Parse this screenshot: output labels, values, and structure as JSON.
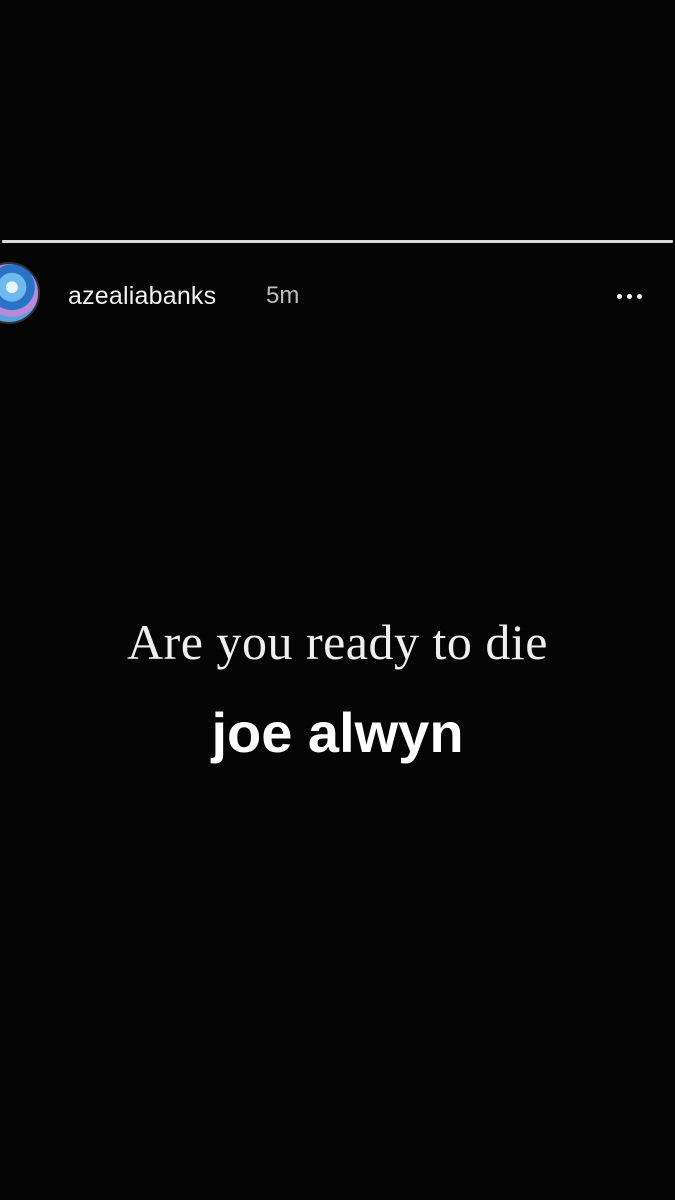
{
  "story": {
    "username": "azealiabanks",
    "timestamp": "5m",
    "more_icon": "more-horizontal-icon",
    "caption_line1": "Are you ready to die",
    "caption_line2": "joe alwyn",
    "progress_segments": 1
  }
}
